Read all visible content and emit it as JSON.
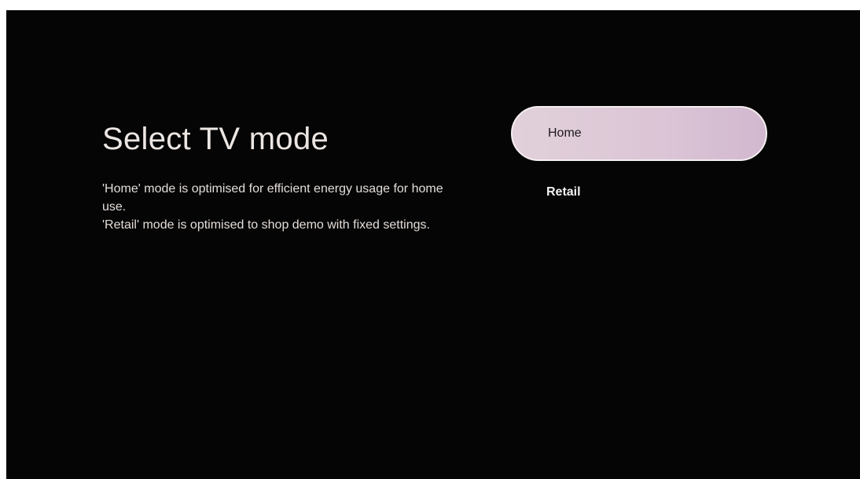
{
  "page": {
    "title": "Select TV mode",
    "description_lines": [
      "'Home' mode is optimised for efficient energy usage for home use.",
      "'Retail' mode is optimised to shop demo with fixed settings."
    ]
  },
  "options": [
    {
      "label": "Home",
      "selected": true
    },
    {
      "label": "Retail",
      "selected": false
    }
  ],
  "colors": {
    "background": "#050505",
    "selected_pill": "#dcc7d6",
    "text": "#ece6e3"
  }
}
